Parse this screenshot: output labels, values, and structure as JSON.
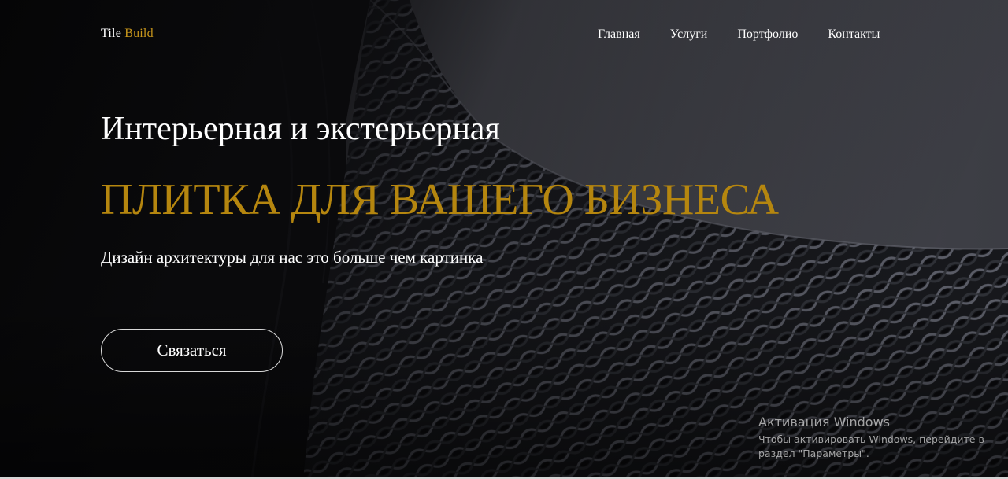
{
  "brand": {
    "name_part1": "Tile",
    "name_part2": "Build",
    "accent_color": "#c9971c"
  },
  "nav": {
    "items": [
      {
        "label": "Главная"
      },
      {
        "label": "Услуги"
      },
      {
        "label": "Портфолио"
      },
      {
        "label": "Контакты"
      }
    ]
  },
  "hero": {
    "headline": "Интерьерная и экстерьерная",
    "title_accent": "ПЛИТКА ДЛЯ ВАШЕГО БИЗНЕСА",
    "subtitle": "Дизайн архитектуры для нас это больше чем картинка",
    "cta_label": "Связаться",
    "accent_color": "#b5860f"
  },
  "watermark": {
    "title": "Активация Windows",
    "text": "Чтобы активировать Windows, перейдите в раздел \"Параметры\"."
  }
}
